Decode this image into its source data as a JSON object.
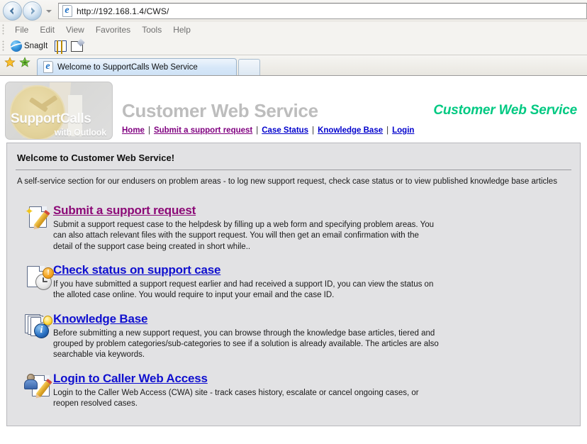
{
  "browser": {
    "address": "http://192.168.1.4/CWS/",
    "back_icon": "back-arrow-icon",
    "forward_icon": "forward-arrow-icon",
    "recent_pages_icon": "chevron-down-icon",
    "menu": [
      "File",
      "Edit",
      "View",
      "Favorites",
      "Tools",
      "Help"
    ],
    "toolbar": {
      "snagit_label": "SnagIt",
      "snagit_icon": "snagit-globe-icon",
      "capture_icon": "snagit-capture-icon",
      "profiles_icon": "snagit-profiles-icon"
    },
    "favorites": {
      "favorites_icon": "star-icon",
      "add_favorites_icon": "add-to-favorites-icon"
    },
    "tab": {
      "title": "Welcome to SupportCalls Web Service",
      "favicon": "internet-explorer-icon",
      "new_tab_label": ""
    }
  },
  "site": {
    "logo": {
      "title": "SupportCalls",
      "subtitle": "with Outlook",
      "icon": "clock-logo-icon"
    },
    "title": "Customer Web Service",
    "tagline": "Customer Web Service",
    "tagline_color": "#00c982",
    "title_color": "#bdbdbd",
    "nav": [
      {
        "label": "Home",
        "state": "visited"
      },
      {
        "label": "Submit a support request",
        "state": "visited"
      },
      {
        "label": "Case Status",
        "state": "unvisited"
      },
      {
        "label": "Knowledge Base",
        "state": "unvisited"
      },
      {
        "label": "Login",
        "state": "unvisited"
      }
    ],
    "nav_separator": "|",
    "link_visited_color": "#800080",
    "link_color": "#0000cc"
  },
  "content": {
    "welcome_title": "Welcome to Customer Web Service!",
    "intro": "A self-service section for our endusers on problem areas - to log new support request, check case status or to view published knowledge base articles",
    "panel_bg": "#e2e2e4",
    "items": [
      {
        "icon": "new-document-pencil-icon",
        "title": "Submit a support request",
        "title_color": "#8c0a77",
        "link_state": "visited",
        "description": "Submit a support request case to the helpdesk by filling up a web form and specifying problem areas. You can also attach relevant files with the support request. You will then get an email confirmation with the detail of the support case being created in short while.."
      },
      {
        "icon": "document-clock-alert-icon",
        "title": "Check status on support case",
        "title_color": "#1010cf",
        "link_state": "unvisited",
        "description": "If you have submitted a support request earlier and had received a support ID, you can view the status on the alloted case online. You would require to input your email and the case ID."
      },
      {
        "icon": "documents-info-bulb-icon",
        "title": "Knowledge Base",
        "title_color": "#1010cf",
        "link_state": "unvisited",
        "description": "Before submitting a new support request, you can browse through the knowledge base articles, tiered and grouped by problem categories/sub-categories to see if a solution is already available. The articles are also searchable via keywords."
      },
      {
        "icon": "user-document-pencil-icon",
        "title": "Login to Caller Web Access",
        "title_color": "#1010cf",
        "link_state": "unvisited",
        "description": "Login to the Caller Web Access (CWA) site - track cases history, escalate or cancel ongoing cases, or reopen resolved cases."
      }
    ]
  }
}
